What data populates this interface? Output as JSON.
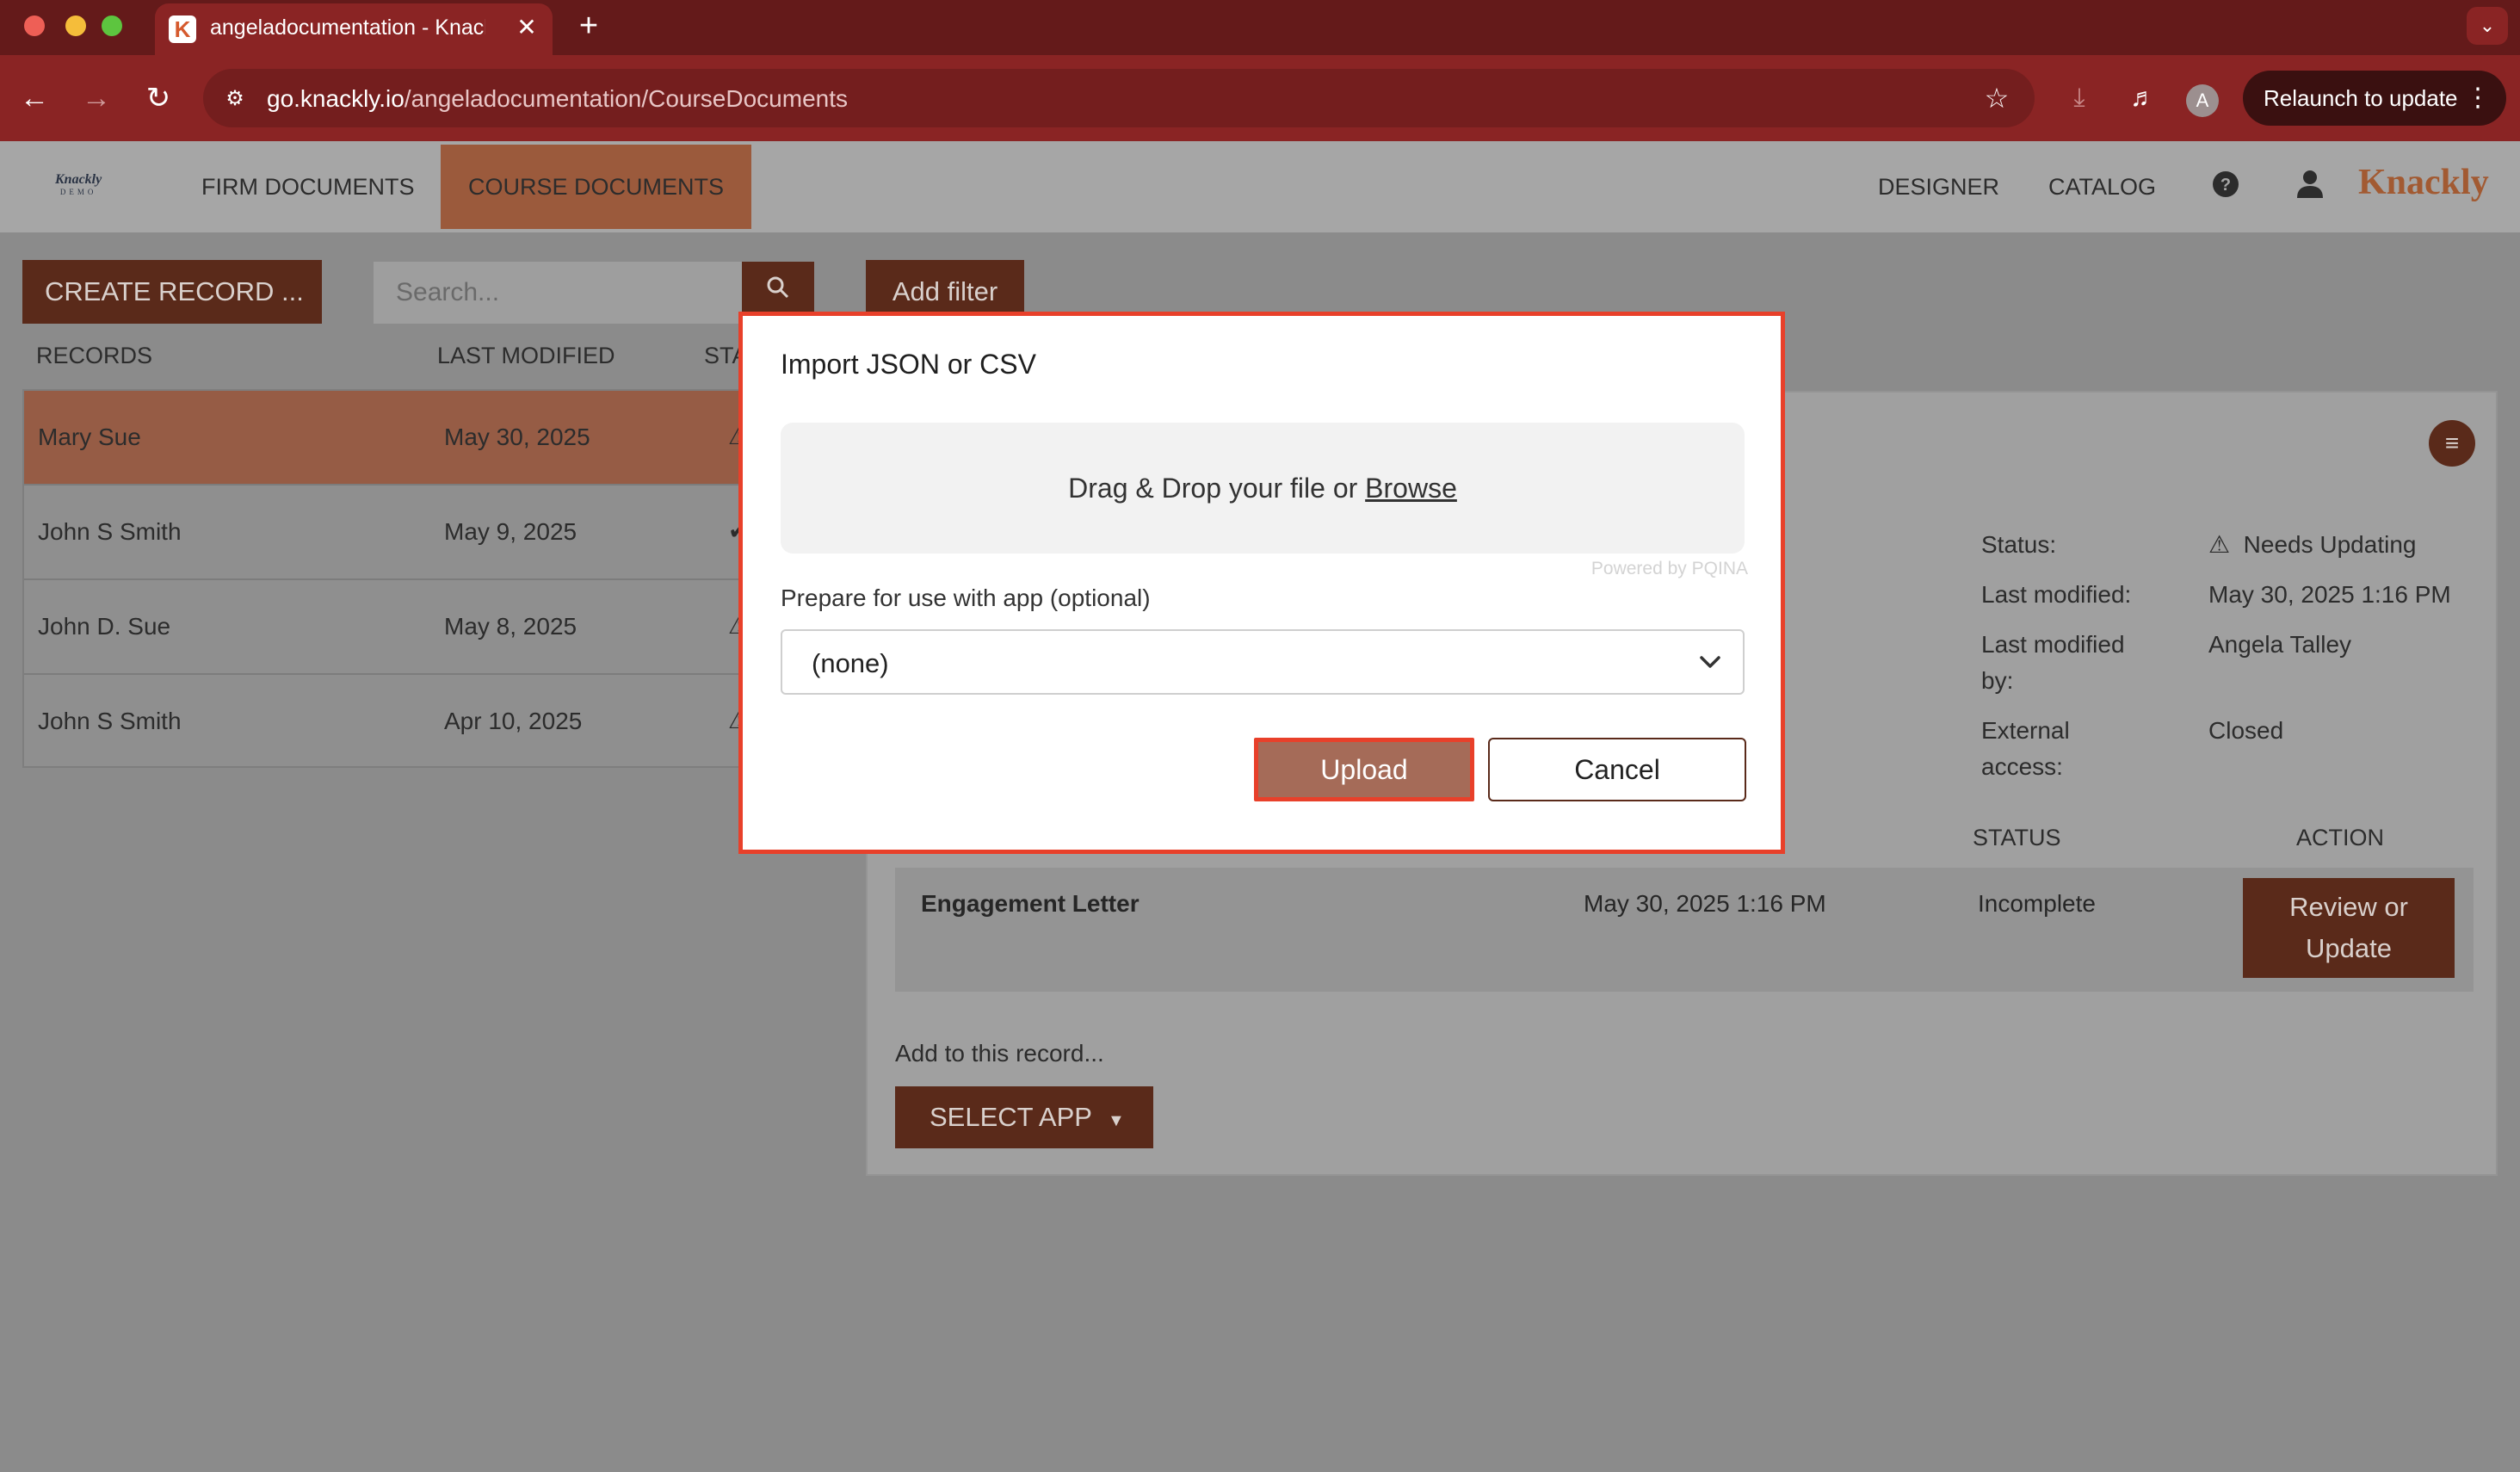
{
  "browser": {
    "tab_title": "angeladocumentation - Knackly",
    "tab_favicon": "K",
    "url_host": "go.knackly.io",
    "url_path": "/angeladocumentation/CourseDocuments",
    "relaunch_label": "Relaunch to update",
    "profile_initial": "A"
  },
  "nav": {
    "logo_small": "Knackly",
    "logo_small_sub": "DEMO",
    "links": [
      "FIRM DOCUMENTS",
      "COURSE DOCUMENTS"
    ],
    "right_links": [
      "DESIGNER",
      "CATALOG"
    ],
    "brand": "Knackly"
  },
  "toolbar": {
    "create_record": "CREATE RECORD  ...",
    "search_placeholder": "Search...",
    "add_filter": "Add filter"
  },
  "records": {
    "headers": [
      "RECORDS",
      "LAST MODIFIED",
      "STA"
    ],
    "rows": [
      {
        "name": "Mary Sue",
        "date": "May 30, 2025",
        "status": "⚠"
      },
      {
        "name": "John S Smith",
        "date": "May 9, 2025",
        "status": "✔"
      },
      {
        "name": "John D. Sue",
        "date": "May 8, 2025",
        "status": "⚠"
      },
      {
        "name": "John S Smith",
        "date": "Apr 10, 2025",
        "status": "⚠"
      }
    ]
  },
  "detail": {
    "status_label": "Status:",
    "status_value": "Needs Updating",
    "last_modified_label": "Last modified:",
    "last_modified_value": "May 30, 2025 1:16 PM",
    "last_modified_by_label_1": "Last modified",
    "last_modified_by_label_2": "by:",
    "last_modified_by_value": "Angela Talley",
    "external_label_1": "External",
    "external_label_2": "access:",
    "external_value": "Closed",
    "col_status": "STATUS",
    "col_action": "ACTION",
    "doc": {
      "name": "Engagement Letter",
      "date": "May 30, 2025 1:16 PM",
      "status": "Incomplete",
      "action_line1": "Review or",
      "action_line2": "Update"
    },
    "add_to_record": "Add to this record...",
    "select_app": "SELECT APP"
  },
  "modal": {
    "title": "Import JSON or CSV",
    "drop_text": "Drag & Drop your file or ",
    "browse": "Browse",
    "powered_by": "Powered by PQINA",
    "prepare_label": "Prepare for use with app (optional)",
    "select_value": "(none)",
    "upload": "Upload",
    "cancel": "Cancel"
  },
  "colors": {
    "chrome_dark": "#641a1a",
    "chrome": "#8a2424",
    "accent": "#5a2a1a",
    "highlight": "#e8402a"
  }
}
